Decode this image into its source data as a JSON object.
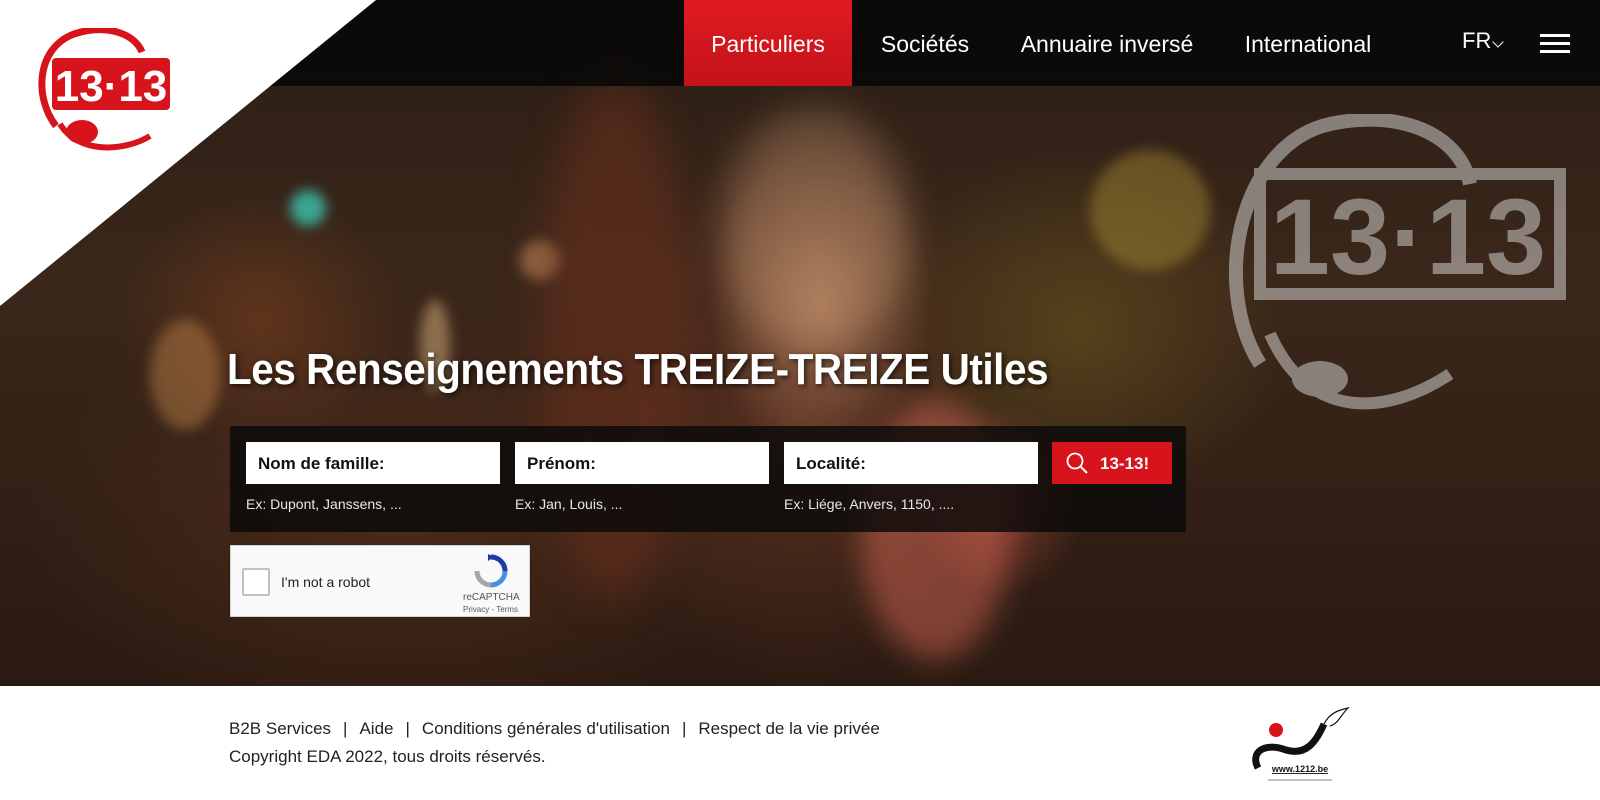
{
  "nav": {
    "items": [
      {
        "label": "Particuliers",
        "active": true
      },
      {
        "label": "Sociétés",
        "active": false
      },
      {
        "label": "Annuaire inversé",
        "active": false
      },
      {
        "label": "International",
        "active": false
      }
    ],
    "language": "FR"
  },
  "logo": {
    "text": "13·13",
    "icon": "headset-logo-icon"
  },
  "hero": {
    "title": "Les Renseignements TREIZE-TREIZE Utiles",
    "watermark_text": "13·13"
  },
  "search": {
    "fields": [
      {
        "label": "Nom de famille:",
        "hint": "Ex: Dupont, Janssens, ..."
      },
      {
        "label": "Prénom:",
        "hint": "Ex: Jan, Louis, ..."
      },
      {
        "label": "Localité:",
        "hint": "Ex: Liége, Anvers, 1150, ...."
      }
    ],
    "button_label": "13-13!",
    "button_icon": "search-icon"
  },
  "captcha": {
    "label": "I'm not a robot",
    "brand": "reCAPTCHA",
    "links": "Privacy - Terms"
  },
  "footer": {
    "links": [
      "B2B Services",
      "Aide",
      "Conditions générales d'utilisation",
      "Respect de la vie privée"
    ],
    "separator": "|",
    "copyright": "Copyright EDA 2022, tous droits réservés.",
    "partner_logo_text": "www.1212.be"
  },
  "colors": {
    "brand_red": "#d7141c",
    "nav_bg": "#080808",
    "footer_text": "#222222"
  }
}
